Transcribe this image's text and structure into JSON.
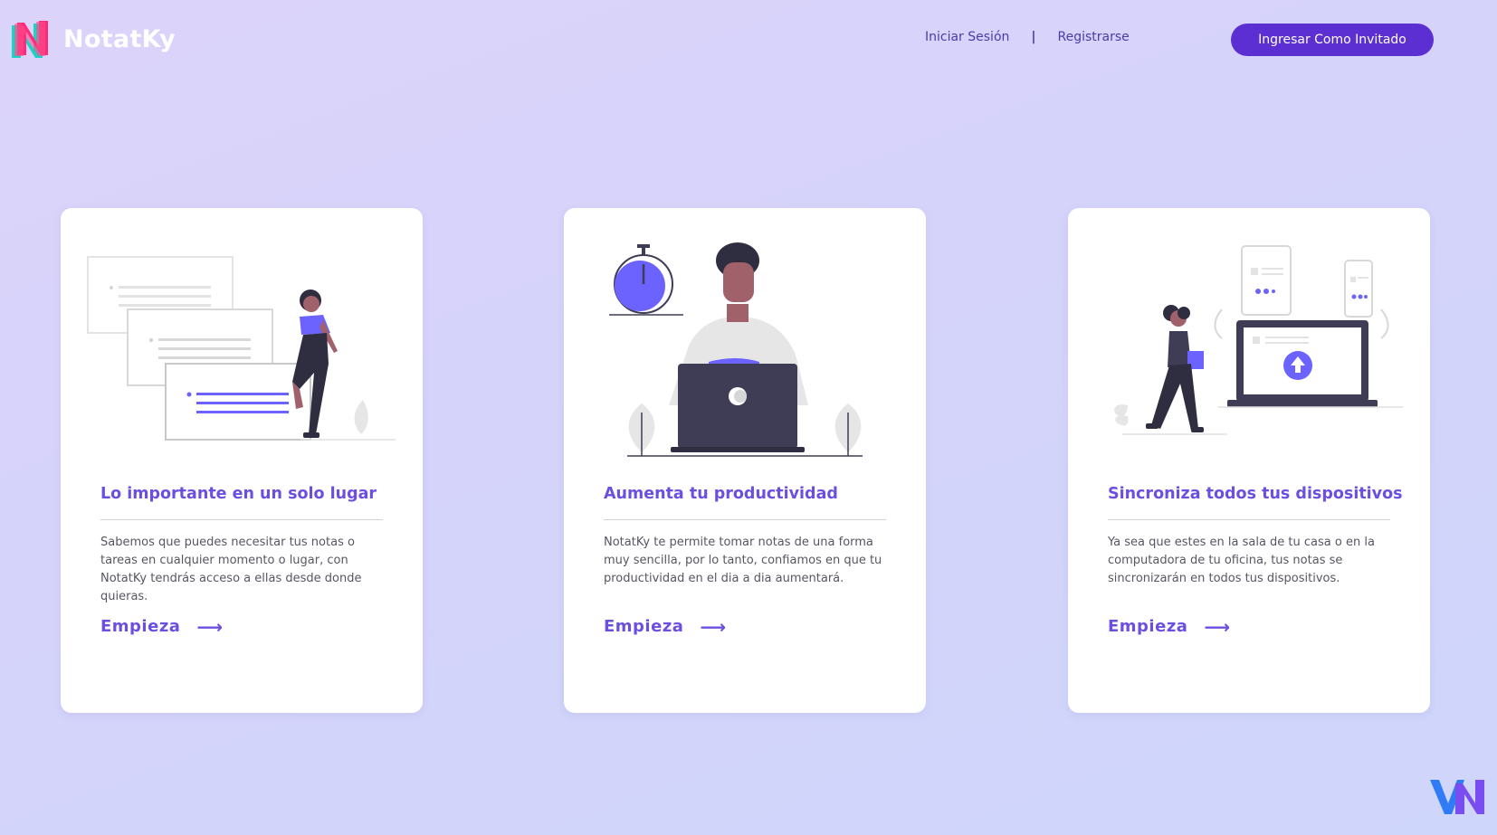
{
  "header": {
    "brand": "NotatKy",
    "nav": {
      "login": "Iniciar Sesión",
      "separator": "|",
      "register": "Registrarse"
    },
    "guest_button": "Ingresar Como Invitado"
  },
  "cards": [
    {
      "title": "Lo importante en un solo lugar",
      "description": "Sabemos que puedes necesitar tus notas o tareas en cualquier momento o lugar, con NotatKy tendrás acceso a ellas desde donde quieras.",
      "cta": "Empieza",
      "arrow": "⟶"
    },
    {
      "title": "Aumenta tu productividad",
      "description": "NotatKy te permite tomar notas de una forma muy sencilla, por lo tanto, confiamos en que tu productividad en el dia a dia aumentará.",
      "cta": "Empieza",
      "arrow": "⟶"
    },
    {
      "title": "Sincroniza todos tus dispositivos",
      "description": "Ya sea que estes en la sala de tu casa o en la computadora de tu oficina, tus notas se sincronizarán en todos tus dispositivos.",
      "cta": "Empieza",
      "arrow": "⟶"
    }
  ],
  "colors": {
    "accent": "#6c4fe0",
    "button": "#5b2fd1",
    "nav_text": "#4d3aa8",
    "illustration_purple": "#6c63ff",
    "illustration_dark": "#3f3d56"
  },
  "icons": [
    "notatky-logo-icon",
    "arrow-right-icon",
    "corner-brand-icon"
  ]
}
